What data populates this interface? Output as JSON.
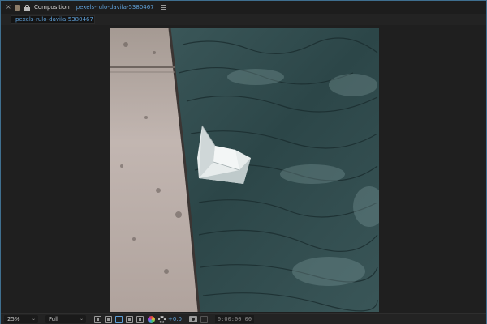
{
  "panel": {
    "title": "Composition",
    "composition_name": "pexels-rulo-davila-5380467",
    "close_glyph": "×",
    "menu_icon": "hamburger-menu-icon"
  },
  "tab": {
    "label": "pexels-rulo-davila-5380467"
  },
  "viewer": {
    "content": "paper-boat-on-water-photo"
  },
  "footer": {
    "zoom": "25%",
    "resolution": "Full",
    "exposure": "+0.0",
    "timecode": "0:00:00:00",
    "chevron": "⌄"
  },
  "colors": {
    "accent": "#5fa0d8",
    "panel_border": "#3f6f8f",
    "background": "#1d1d1d",
    "water": "#2f4a4c",
    "concrete": "#b7aba6"
  }
}
